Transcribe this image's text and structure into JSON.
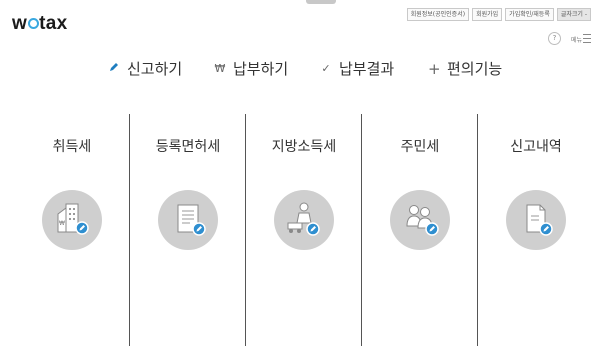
{
  "header": {
    "logo_left": "w",
    "logo_right": "tax",
    "utility_links": [
      "회원정보(공인인증서)",
      "회원가입",
      "가입확인/재등록",
      "글자크기 -"
    ],
    "help_label": "?",
    "menu_label": "메뉴"
  },
  "nav": {
    "items": [
      {
        "label": "신고하기",
        "icon": "pencil-icon",
        "active": true
      },
      {
        "label": "납부하기",
        "icon": "won-icon",
        "active": false
      },
      {
        "label": "납부결과",
        "icon": "check-icon",
        "active": false
      },
      {
        "label": "편의기능",
        "icon": "plus-icon",
        "active": false
      }
    ]
  },
  "services": [
    {
      "label": "취득세",
      "icon": "building-icon"
    },
    {
      "label": "등록면허세",
      "icon": "document-icon"
    },
    {
      "label": "지방소득세",
      "icon": "worker-icon"
    },
    {
      "label": "주민세",
      "icon": "people-icon"
    },
    {
      "label": "신고내역",
      "icon": "history-icon"
    }
  ],
  "colors": {
    "accent": "#39a8e0",
    "circle": "#cfcfcf",
    "badge": "#2f8fd0"
  }
}
